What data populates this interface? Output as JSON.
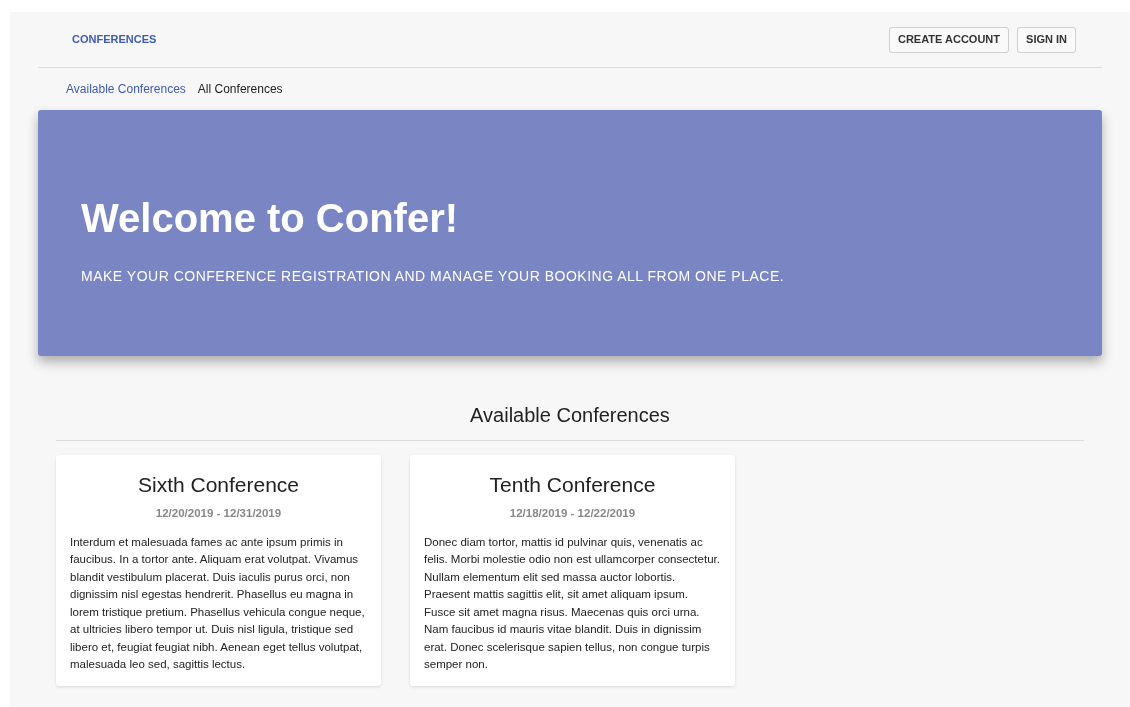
{
  "header": {
    "brand": "CONFERENCES",
    "buttons": [
      "CREATE ACCOUNT",
      "SIGN IN"
    ]
  },
  "tabs": [
    {
      "label": "Available Conferences",
      "selected": true
    },
    {
      "label": "All Conferences",
      "selected": false
    }
  ],
  "hero": {
    "title": "Welcome to Confer!",
    "subtitle": "MAKE YOUR CONFERENCE REGISTRATION AND MANAGE YOUR BOOKING ALL FROM ONE PLACE."
  },
  "section_title": "Available Conferences",
  "conferences": [
    {
      "title": "Sixth Conference",
      "dates": "12/20/2019 - 12/31/2019",
      "description": "Interdum et malesuada fames ac ante ipsum primis in faucibus. In a tortor ante. Aliquam erat volutpat. Vivamus blandit vestibulum placerat. Duis iaculis purus orci, non dignissim nisl egestas hendrerit. Phasellus eu magna in lorem tristique pretium. Phasellus vehicula congue neque, at ultricies libero tempor ut. Duis nisl ligula, tristique sed libero et, feugiat feugiat nibh. Aenean eget tellus volutpat, malesuada leo sed, sagittis lectus."
    },
    {
      "title": "Tenth Conference",
      "dates": "12/18/2019 - 12/22/2019",
      "description": "Donec diam tortor, mattis id pulvinar quis, venenatis ac felis. Morbi molestie odio non est ullamcorper consectetur. Nullam elementum elit sed massa auctor lobortis. Praesent mattis sagittis elit, sit amet aliquam ipsum. Fusce sit amet magna risus. Maecenas quis orci urna. Nam faucibus id mauris vitae blandit. Duis in dignissim erat. Donec scelerisque sapien tellus, non congue turpis semper non."
    }
  ]
}
